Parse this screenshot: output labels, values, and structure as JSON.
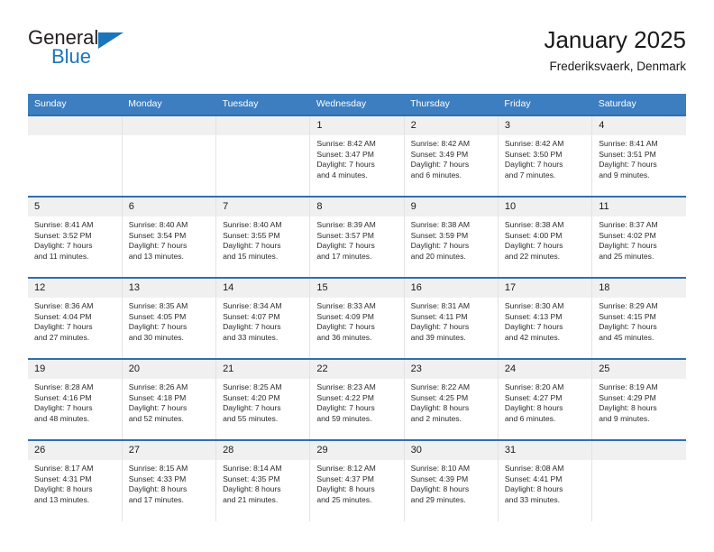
{
  "brand": {
    "name_top": "General",
    "name_bottom": "Blue",
    "flag_icon": "triangle-flag-icon",
    "color_primary": "#1b75bb"
  },
  "header": {
    "title": "January 2025",
    "subtitle": "Frederiksvaerk, Denmark"
  },
  "theme": {
    "header_blue": "#3c7ec0",
    "row_border_blue": "#2f6fb0",
    "daynum_band": "#f0f0f0"
  },
  "weekdays": [
    "Sunday",
    "Monday",
    "Tuesday",
    "Wednesday",
    "Thursday",
    "Friday",
    "Saturday"
  ],
  "weeks": [
    [
      {
        "day": "",
        "empty": true
      },
      {
        "day": "",
        "empty": true
      },
      {
        "day": "",
        "empty": true
      },
      {
        "day": "1",
        "sunrise": "Sunrise: 8:42 AM",
        "sunset": "Sunset: 3:47 PM",
        "daylight1": "Daylight: 7 hours",
        "daylight2": "and 4 minutes."
      },
      {
        "day": "2",
        "sunrise": "Sunrise: 8:42 AM",
        "sunset": "Sunset: 3:49 PM",
        "daylight1": "Daylight: 7 hours",
        "daylight2": "and 6 minutes."
      },
      {
        "day": "3",
        "sunrise": "Sunrise: 8:42 AM",
        "sunset": "Sunset: 3:50 PM",
        "daylight1": "Daylight: 7 hours",
        "daylight2": "and 7 minutes."
      },
      {
        "day": "4",
        "sunrise": "Sunrise: 8:41 AM",
        "sunset": "Sunset: 3:51 PM",
        "daylight1": "Daylight: 7 hours",
        "daylight2": "and 9 minutes."
      }
    ],
    [
      {
        "day": "5",
        "sunrise": "Sunrise: 8:41 AM",
        "sunset": "Sunset: 3:52 PM",
        "daylight1": "Daylight: 7 hours",
        "daylight2": "and 11 minutes."
      },
      {
        "day": "6",
        "sunrise": "Sunrise: 8:40 AM",
        "sunset": "Sunset: 3:54 PM",
        "daylight1": "Daylight: 7 hours",
        "daylight2": "and 13 minutes."
      },
      {
        "day": "7",
        "sunrise": "Sunrise: 8:40 AM",
        "sunset": "Sunset: 3:55 PM",
        "daylight1": "Daylight: 7 hours",
        "daylight2": "and 15 minutes."
      },
      {
        "day": "8",
        "sunrise": "Sunrise: 8:39 AM",
        "sunset": "Sunset: 3:57 PM",
        "daylight1": "Daylight: 7 hours",
        "daylight2": "and 17 minutes."
      },
      {
        "day": "9",
        "sunrise": "Sunrise: 8:38 AM",
        "sunset": "Sunset: 3:59 PM",
        "daylight1": "Daylight: 7 hours",
        "daylight2": "and 20 minutes."
      },
      {
        "day": "10",
        "sunrise": "Sunrise: 8:38 AM",
        "sunset": "Sunset: 4:00 PM",
        "daylight1": "Daylight: 7 hours",
        "daylight2": "and 22 minutes."
      },
      {
        "day": "11",
        "sunrise": "Sunrise: 8:37 AM",
        "sunset": "Sunset: 4:02 PM",
        "daylight1": "Daylight: 7 hours",
        "daylight2": "and 25 minutes."
      }
    ],
    [
      {
        "day": "12",
        "sunrise": "Sunrise: 8:36 AM",
        "sunset": "Sunset: 4:04 PM",
        "daylight1": "Daylight: 7 hours",
        "daylight2": "and 27 minutes."
      },
      {
        "day": "13",
        "sunrise": "Sunrise: 8:35 AM",
        "sunset": "Sunset: 4:05 PM",
        "daylight1": "Daylight: 7 hours",
        "daylight2": "and 30 minutes."
      },
      {
        "day": "14",
        "sunrise": "Sunrise: 8:34 AM",
        "sunset": "Sunset: 4:07 PM",
        "daylight1": "Daylight: 7 hours",
        "daylight2": "and 33 minutes."
      },
      {
        "day": "15",
        "sunrise": "Sunrise: 8:33 AM",
        "sunset": "Sunset: 4:09 PM",
        "daylight1": "Daylight: 7 hours",
        "daylight2": "and 36 minutes."
      },
      {
        "day": "16",
        "sunrise": "Sunrise: 8:31 AM",
        "sunset": "Sunset: 4:11 PM",
        "daylight1": "Daylight: 7 hours",
        "daylight2": "and 39 minutes."
      },
      {
        "day": "17",
        "sunrise": "Sunrise: 8:30 AM",
        "sunset": "Sunset: 4:13 PM",
        "daylight1": "Daylight: 7 hours",
        "daylight2": "and 42 minutes."
      },
      {
        "day": "18",
        "sunrise": "Sunrise: 8:29 AM",
        "sunset": "Sunset: 4:15 PM",
        "daylight1": "Daylight: 7 hours",
        "daylight2": "and 45 minutes."
      }
    ],
    [
      {
        "day": "19",
        "sunrise": "Sunrise: 8:28 AM",
        "sunset": "Sunset: 4:16 PM",
        "daylight1": "Daylight: 7 hours",
        "daylight2": "and 48 minutes."
      },
      {
        "day": "20",
        "sunrise": "Sunrise: 8:26 AM",
        "sunset": "Sunset: 4:18 PM",
        "daylight1": "Daylight: 7 hours",
        "daylight2": "and 52 minutes."
      },
      {
        "day": "21",
        "sunrise": "Sunrise: 8:25 AM",
        "sunset": "Sunset: 4:20 PM",
        "daylight1": "Daylight: 7 hours",
        "daylight2": "and 55 minutes."
      },
      {
        "day": "22",
        "sunrise": "Sunrise: 8:23 AM",
        "sunset": "Sunset: 4:22 PM",
        "daylight1": "Daylight: 7 hours",
        "daylight2": "and 59 minutes."
      },
      {
        "day": "23",
        "sunrise": "Sunrise: 8:22 AM",
        "sunset": "Sunset: 4:25 PM",
        "daylight1": "Daylight: 8 hours",
        "daylight2": "and 2 minutes."
      },
      {
        "day": "24",
        "sunrise": "Sunrise: 8:20 AM",
        "sunset": "Sunset: 4:27 PM",
        "daylight1": "Daylight: 8 hours",
        "daylight2": "and 6 minutes."
      },
      {
        "day": "25",
        "sunrise": "Sunrise: 8:19 AM",
        "sunset": "Sunset: 4:29 PM",
        "daylight1": "Daylight: 8 hours",
        "daylight2": "and 9 minutes."
      }
    ],
    [
      {
        "day": "26",
        "sunrise": "Sunrise: 8:17 AM",
        "sunset": "Sunset: 4:31 PM",
        "daylight1": "Daylight: 8 hours",
        "daylight2": "and 13 minutes."
      },
      {
        "day": "27",
        "sunrise": "Sunrise: 8:15 AM",
        "sunset": "Sunset: 4:33 PM",
        "daylight1": "Daylight: 8 hours",
        "daylight2": "and 17 minutes."
      },
      {
        "day": "28",
        "sunrise": "Sunrise: 8:14 AM",
        "sunset": "Sunset: 4:35 PM",
        "daylight1": "Daylight: 8 hours",
        "daylight2": "and 21 minutes."
      },
      {
        "day": "29",
        "sunrise": "Sunrise: 8:12 AM",
        "sunset": "Sunset: 4:37 PM",
        "daylight1": "Daylight: 8 hours",
        "daylight2": "and 25 minutes."
      },
      {
        "day": "30",
        "sunrise": "Sunrise: 8:10 AM",
        "sunset": "Sunset: 4:39 PM",
        "daylight1": "Daylight: 8 hours",
        "daylight2": "and 29 minutes."
      },
      {
        "day": "31",
        "sunrise": "Sunrise: 8:08 AM",
        "sunset": "Sunset: 4:41 PM",
        "daylight1": "Daylight: 8 hours",
        "daylight2": "and 33 minutes."
      },
      {
        "day": "",
        "empty": true
      }
    ]
  ]
}
